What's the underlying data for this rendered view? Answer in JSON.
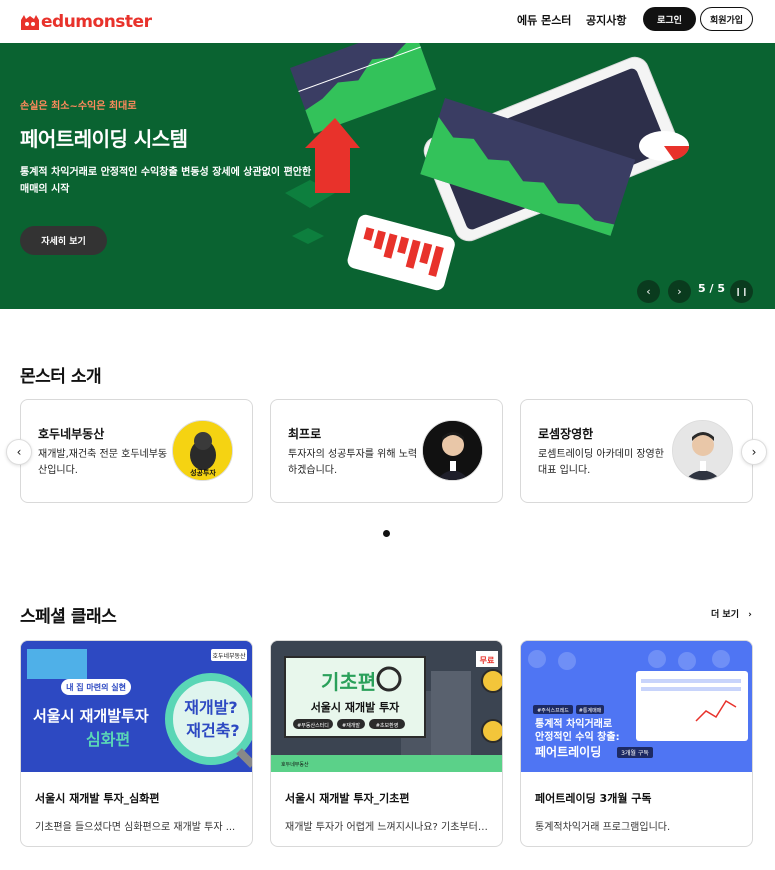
{
  "header": {
    "logo": "edumonster",
    "nav": [
      "에듀 몬스터",
      "공지사항"
    ],
    "login_label": "로그인",
    "signup_label": "회원가입"
  },
  "hero": {
    "kicker": "손실은 최소~수익은 최대로",
    "title": "페어트레이딩 시스템",
    "description": "통계적 차익거래로 안정적인 수익창출 변동성 장세에 상관없이 편안한 매매의 시작",
    "cta_label": "자세히 보기",
    "prev_icon": "‹",
    "next_icon": "›",
    "pause_icon": "❙❙",
    "counter": "5 / 5",
    "colors": {
      "background": "#0a6331",
      "accent": "#e8322b"
    }
  },
  "monsters": {
    "title": "몬스터 소개",
    "cards": [
      {
        "name": "호두네부동산",
        "desc": "재개발,재건축 전문 호두네부동산입니다.",
        "avatar_text": "성공투자"
      },
      {
        "name": "최프로",
        "desc": "투자자의 성공투자를 위해 노력하겠습니다."
      },
      {
        "name": "로셈장영한",
        "desc": "로셈트레이딩 아카데미 장영한 대표 입니다."
      }
    ],
    "prev_icon": "‹",
    "next_icon": "›"
  },
  "special": {
    "title": "스페셜 클래스",
    "more_label": "더 보기",
    "more_icon": "›",
    "cards": [
      {
        "title": "서울시 재개발 투자_심화편",
        "desc": "기초편을 들으셨다면 심화편으로 재개발 투자 ...",
        "thumb": {
          "tag": "내 집 마련의 실현",
          "main": "서울시 재개발투자",
          "sub": "심화편",
          "bubble1": "재개발?",
          "bubble2": "재건축?",
          "brand": "호두네부동산"
        }
      },
      {
        "title": "서울시 재개발 투자_기초편",
        "desc": "재개발 투자가 어렵게 느껴지시나요? 기초부터 ...",
        "thumb": {
          "main": "기초편",
          "sub": "서울시 재개발 투자",
          "tags": [
            "#부동산스터디",
            "#재개발",
            "#초보환영"
          ],
          "badge": "무료",
          "brand": "호두네부동산"
        }
      },
      {
        "title": "페어트레이딩 3개월 구독",
        "desc": "통계적차익거래 프로그램입니다.",
        "thumb": {
          "tags": [
            "#주식스프레드",
            "#통계매매"
          ],
          "line1": "통계적 차익거래로",
          "line2": "안정적인 수익 창출:",
          "main": "페어트레이딩",
          "badge": "3개월 구독"
        }
      }
    ]
  }
}
